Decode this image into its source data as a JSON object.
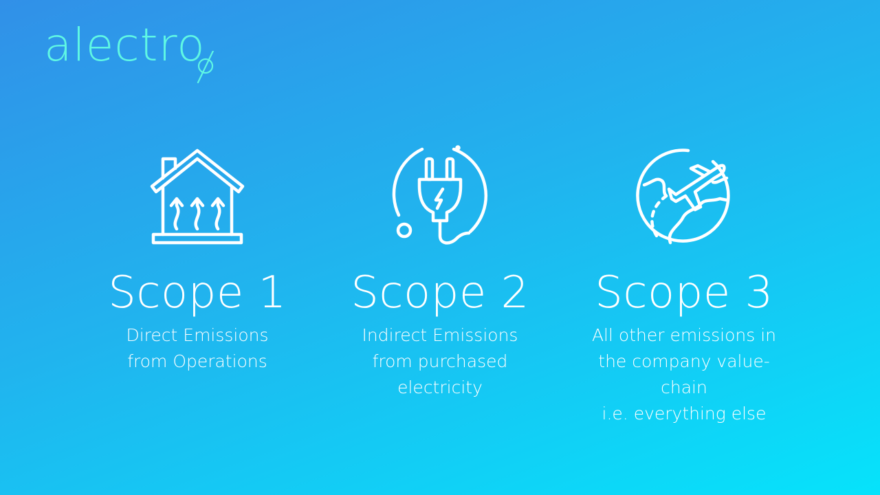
{
  "brand": {
    "name": "alectro",
    "accent_color": "#5ff7e4"
  },
  "background": {
    "gradient_start": "#3190e8",
    "gradient_end": "#06e3fb"
  },
  "scopes": [
    {
      "icon": "house-heat-icon",
      "title": "Scope 1",
      "description_lines": [
        "Direct Emissions",
        "from Operations"
      ]
    },
    {
      "icon": "electric-plug-icon",
      "title": "Scope 2",
      "description_lines": [
        "Indirect Emissions",
        "from purchased",
        "electricity"
      ]
    },
    {
      "icon": "globe-airplane-icon",
      "title": "Scope 3",
      "description_lines": [
        "All other emissions in",
        "the company value-",
        "chain",
        "i.e. everything else"
      ]
    }
  ]
}
